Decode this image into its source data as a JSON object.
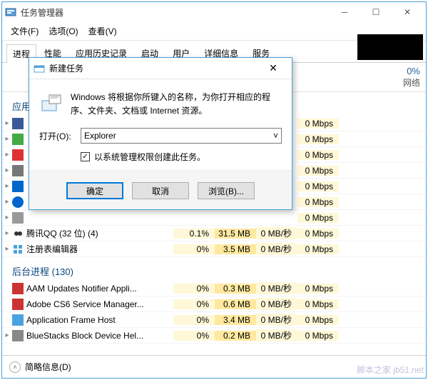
{
  "window": {
    "title": "任务管理器",
    "menu": [
      "文件(F)",
      "选项(O)",
      "查看(V)"
    ],
    "tabs": [
      "进程",
      "性能",
      "应用历史记录",
      "启动",
      "用户",
      "详细信息",
      "服务"
    ]
  },
  "columns": {
    "net_pct": "0%",
    "net_label": "网络"
  },
  "group_apps": "应用",
  "group_bg": "后台进程 (130)",
  "processes": [
    {
      "name": "腾讯QQ (32 位) (4)",
      "cpu": "0.1%",
      "mem": "31.5 MB",
      "disk": "0 MB/秒",
      "net": "0 Mbps"
    },
    {
      "name": "注册表编辑器",
      "cpu": "0%",
      "mem": "3.5 MB",
      "disk": "0 MB/秒",
      "net": "0 Mbps"
    }
  ],
  "bg_processes": [
    {
      "name": "AAM Updates Notifier Appli...",
      "cpu": "0%",
      "mem": "0.3 MB",
      "disk": "0 MB/秒",
      "net": "0 Mbps"
    },
    {
      "name": "Adobe CS6 Service Manager...",
      "cpu": "0%",
      "mem": "0.6 MB",
      "disk": "0 MB/秒",
      "net": "0 Mbps"
    },
    {
      "name": "Application Frame Host",
      "cpu": "0%",
      "mem": "3.4 MB",
      "disk": "0 MB/秒",
      "net": "0 Mbps"
    },
    {
      "name": "BlueStacks Block Device Hel...",
      "cpu": "0%",
      "mem": "0.2 MB",
      "disk": "0 MB/秒",
      "net": "0 Mbps"
    }
  ],
  "hidden_net": [
    "0 Mbps",
    "0 Mbps",
    "0 Mbps",
    "0 Mbps",
    "0 Mbps",
    "0 Mbps",
    "0 Mbps"
  ],
  "footer": {
    "brief": "简略信息(D)"
  },
  "dialog": {
    "title": "新建任务",
    "message": "Windows 将根据你所键入的名称，为你打开相应的程序、文件夹、文档或 Internet 资源。",
    "open_label": "打开(O):",
    "value": "Explorer",
    "admin_check": "以系统管理权限创建此任务。",
    "ok": "确定",
    "cancel": "取消",
    "browse": "浏览(B)..."
  },
  "watermark": "脚本之家 jb51.net"
}
